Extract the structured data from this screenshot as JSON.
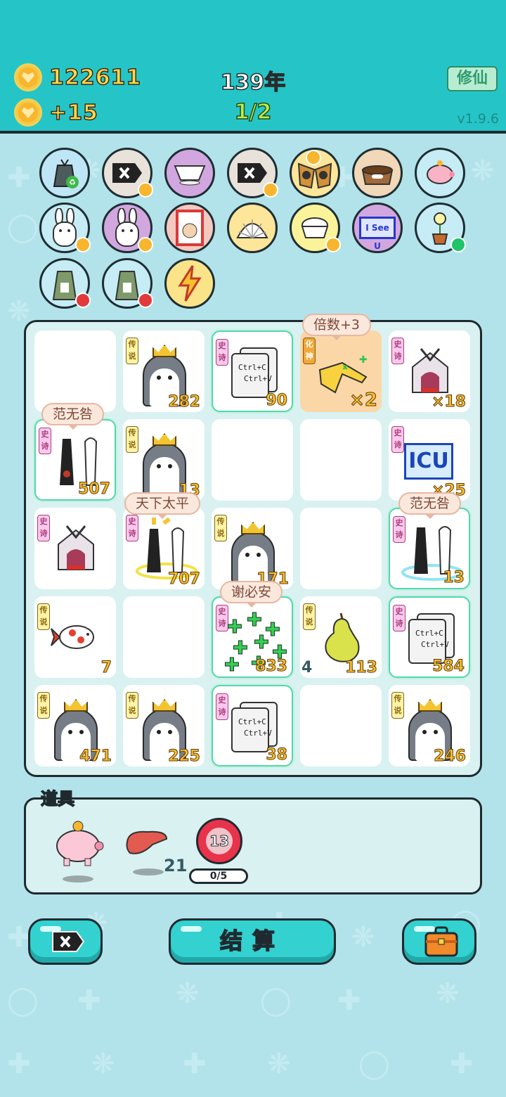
{
  "header": {
    "coins": "122611",
    "income": "+15",
    "years": "139年",
    "progress": "1/2",
    "cultivate_label": "修仙",
    "version": "v1.9.6"
  },
  "relics": [
    {
      "icon": "recycle-bag-icon"
    },
    {
      "icon": "delete-tag-icon"
    },
    {
      "icon": "gravy-boat-icon"
    },
    {
      "icon": "delete-tag-icon"
    },
    {
      "icon": "owl-mask-icon"
    },
    {
      "icon": "pet-bowl-icon"
    },
    {
      "icon": "piggy-bank-icon"
    },
    {
      "icon": "bunny-icon"
    },
    {
      "icon": "bunny-icon"
    },
    {
      "icon": "time-magazine-icon"
    },
    {
      "icon": "shell-icon"
    },
    {
      "icon": "rice-bowl-icon"
    },
    {
      "icon": "i-see-u-sign-icon",
      "text": "I See U"
    },
    {
      "icon": "flower-pot-icon"
    },
    {
      "icon": "sack-icon"
    },
    {
      "icon": "sack-icon"
    },
    {
      "icon": "lightning-icon"
    }
  ],
  "board": {
    "tags": {
      "legend": "传说",
      "epic": "史诗",
      "god": "化神"
    },
    "ctrl_text": {
      "c": "Ctrl+C",
      "v": "Ctrl+V"
    },
    "icu_text": "ICU",
    "bubbles": {
      "multiplier": "倍数+3",
      "fan1": "范无咎",
      "peace": "天下太平",
      "fan2": "范无咎",
      "xie": "谢必安"
    },
    "values": {
      "r0c1": "282",
      "r0c2": "90",
      "r0c3": "×2",
      "r0c4": "×18",
      "r1c0": "507",
      "r1c1": "13",
      "r1c4": "×25",
      "r2c1": "707",
      "r2c2": "171",
      "r2c4": "13",
      "r3c0": "7",
      "r3c2": "833",
      "r3c3_left": "4",
      "r3c3": "113",
      "r3c4": "584",
      "r4c0": "471",
      "r4c1": "225",
      "r4c2": "38",
      "r4c4": "246"
    }
  },
  "items": {
    "title": "道具",
    "liver_count": "21",
    "shield_value": "13",
    "shield_progress": "0/5"
  },
  "buttons": {
    "settle": "结算"
  }
}
